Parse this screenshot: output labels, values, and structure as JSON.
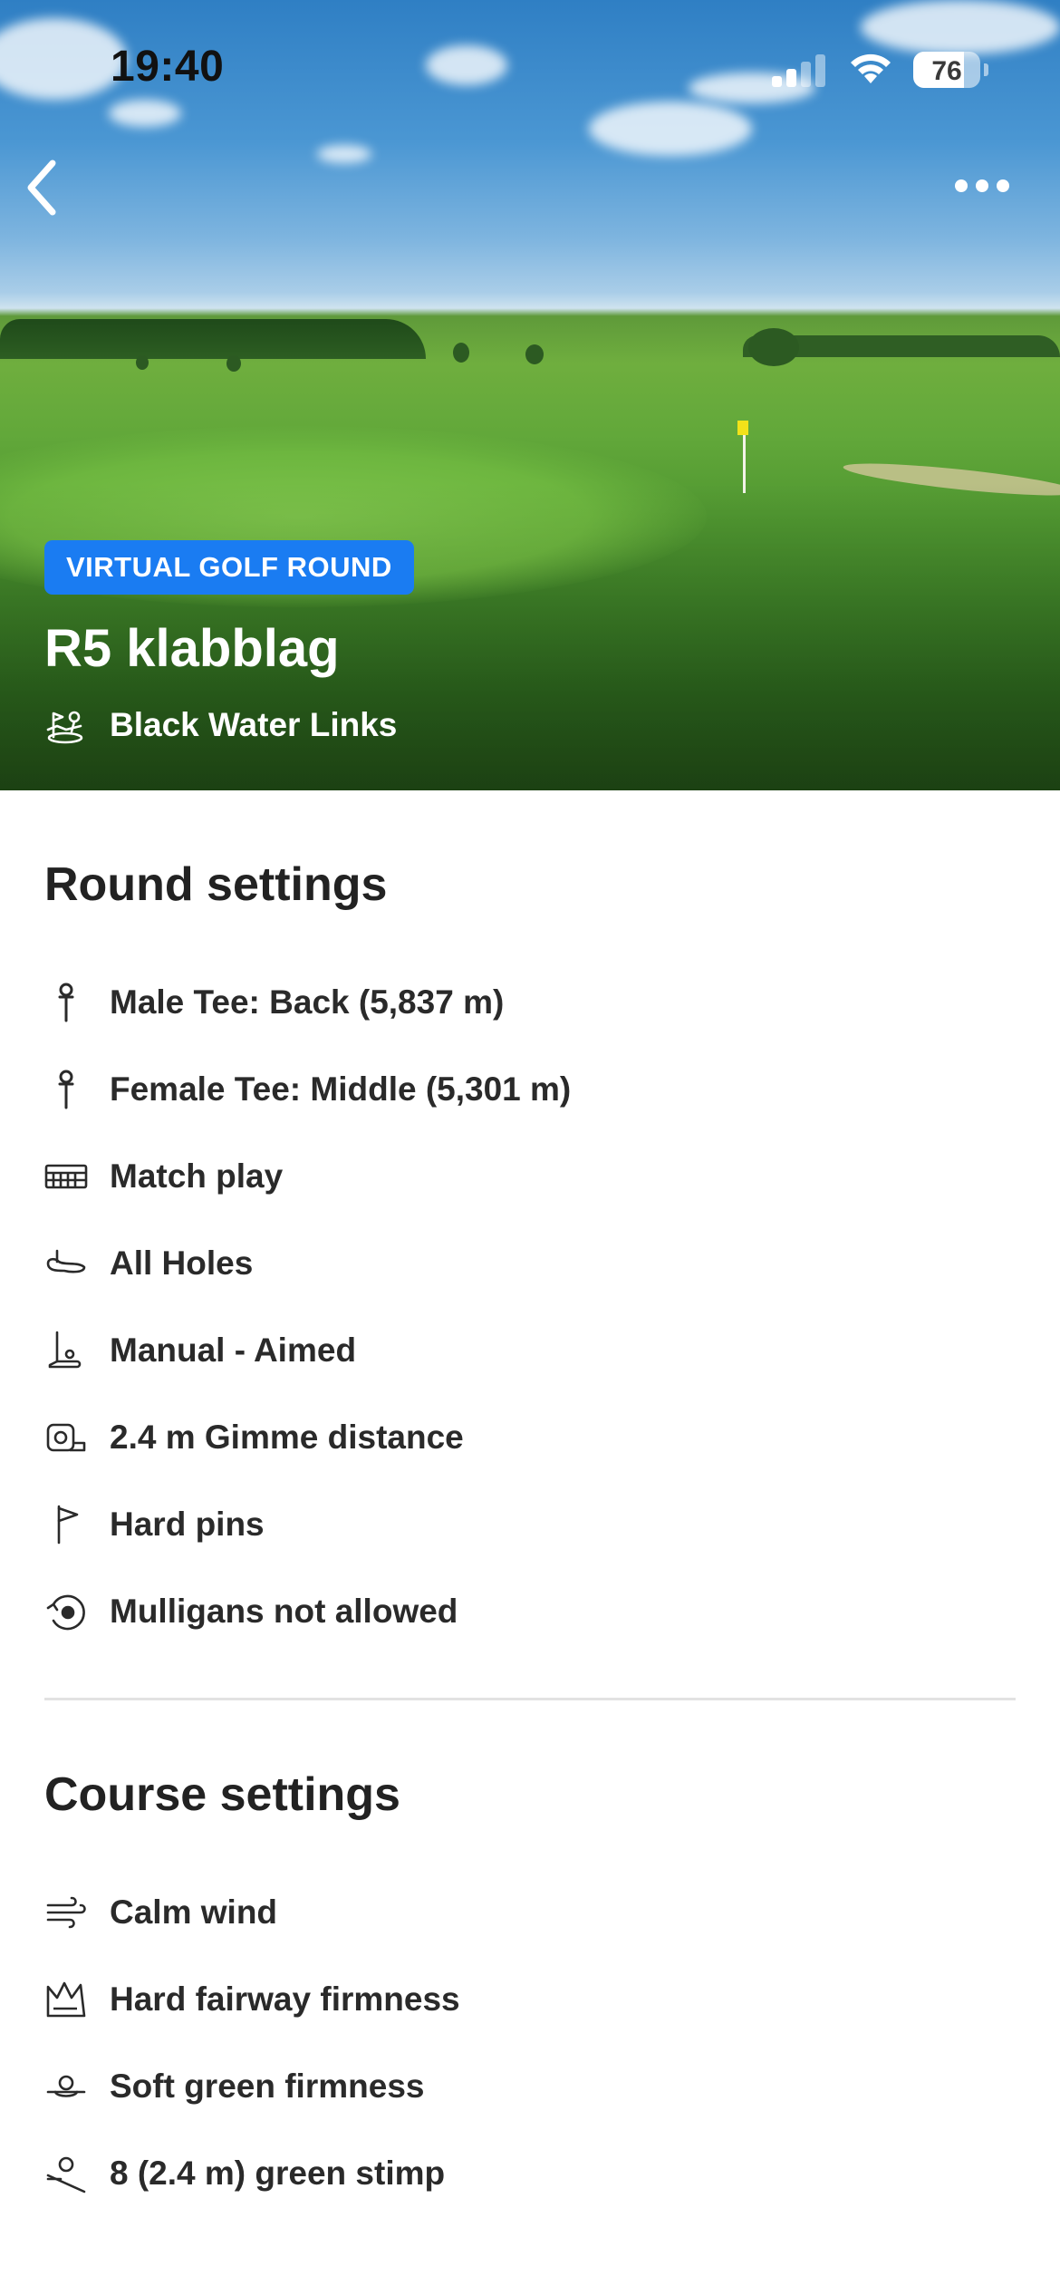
{
  "status_bar": {
    "time": "19:40",
    "battery_percent": "76",
    "battery_level": 0.76,
    "signal_bars_active": 2,
    "signal_bars_total": 4
  },
  "header": {
    "back_icon": "chevron-left-icon",
    "more_icon": "more-horizontal-icon"
  },
  "hero": {
    "badge": "VIRTUAL GOLF ROUND",
    "title": "R5 klabblag",
    "course_icon": "golf-course-icon",
    "course_name": "Black Water Links"
  },
  "round_settings": {
    "title": "Round settings",
    "items": [
      {
        "icon": "tee-icon",
        "label": "Male Tee: Back (5,837 m)"
      },
      {
        "icon": "tee-icon",
        "label": "Female Tee: Middle (5,301 m)"
      },
      {
        "icon": "scorecard-icon",
        "label": "Match play"
      },
      {
        "icon": "holes-icon",
        "label": "All Holes"
      },
      {
        "icon": "putter-icon",
        "label": "Manual - Aimed"
      },
      {
        "icon": "measure-tape-icon",
        "label": "2.4 m Gimme distance"
      },
      {
        "icon": "flag-icon",
        "label": "Hard pins"
      },
      {
        "icon": "mulligan-icon",
        "label": "Mulligans not allowed"
      }
    ]
  },
  "course_settings": {
    "title": "Course settings",
    "items": [
      {
        "icon": "wind-icon",
        "label": "Calm wind"
      },
      {
        "icon": "fairway-firmness-icon",
        "label": "Hard fairway firmness"
      },
      {
        "icon": "green-firmness-icon",
        "label": "Soft green firmness"
      },
      {
        "icon": "green-stimp-icon",
        "label": "8 (2.4 m) green stimp"
      }
    ]
  }
}
